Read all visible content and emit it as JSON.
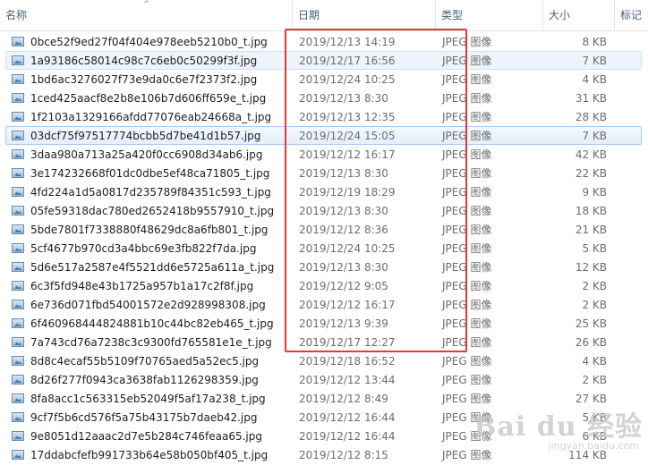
{
  "columns": {
    "name": "名称",
    "date": "日期",
    "type": "类型",
    "size": "大小",
    "tags": "标记"
  },
  "files": [
    {
      "name": "0bce52f9ed27f04f404e978eeb5210b0_t.jpg",
      "date": "2019/12/13 14:19",
      "type": "JPEG 图像",
      "size": "8 KB"
    },
    {
      "name": "1a93186c58014c98c7c6eb0c50299f3f.jpg",
      "date": "2019/12/17 16:56",
      "type": "JPEG 图像",
      "size": "7 KB"
    },
    {
      "name": "1bd6ac3276027f73e9da0c6e7f2373f2.jpg",
      "date": "2019/12/24 10:25",
      "type": "JPEG 图像",
      "size": "4 KB"
    },
    {
      "name": "1ced425aacf8e2b8e106b7d606ff659e_t.jpg",
      "date": "2019/12/13 8:30",
      "type": "JPEG 图像",
      "size": "31 KB"
    },
    {
      "name": "1f2103a1329166afdd77076eab24668a_t.jpg",
      "date": "2019/12/13 12:35",
      "type": "JPEG 图像",
      "size": "28 KB"
    },
    {
      "name": "03dcf75f97517774bcbb5d7be41d1b57.jpg",
      "date": "2019/12/24 15:05",
      "type": "JPEG 图像",
      "size": "7 KB"
    },
    {
      "name": "3daa980a713a25a420f0cc6908d34ab6.jpg",
      "date": "2019/12/12 16:17",
      "type": "JPEG 图像",
      "size": "42 KB"
    },
    {
      "name": "3e174232668f01dc0dbe5ef48ca71805_t.jpg",
      "date": "2019/12/13 8:30",
      "type": "JPEG 图像",
      "size": "22 KB"
    },
    {
      "name": "4fd224a1d5a0817d235789f84351c593_t.jpg",
      "date": "2019/12/19 18:29",
      "type": "JPEG 图像",
      "size": "9 KB"
    },
    {
      "name": "05fe59318dac780ed2652418b9557910_t.jpg",
      "date": "2019/12/13 8:30",
      "type": "JPEG 图像",
      "size": "18 KB"
    },
    {
      "name": "5bde7801f7338880f48629dc8a6fb801_t.jpg",
      "date": "2019/12/12 8:36",
      "type": "JPEG 图像",
      "size": "21 KB"
    },
    {
      "name": "5cf4677b970cd3a4bbc69e3fb822f7da.jpg",
      "date": "2019/12/24 10:25",
      "type": "JPEG 图像",
      "size": "5 KB"
    },
    {
      "name": "5d6e517a2587e4f5521dd6e5725a611a_t.jpg",
      "date": "2019/12/13 8:30",
      "type": "JPEG 图像",
      "size": "12 KB"
    },
    {
      "name": "6c3f5fd948e43b1725a957b1a17c2f8f.jpg",
      "date": "2019/12/12 9:05",
      "type": "JPEG 图像",
      "size": "2 KB"
    },
    {
      "name": "6e736d071fbd54001572e2d928998308.jpg",
      "date": "2019/12/12 16:17",
      "type": "JPEG 图像",
      "size": "2 KB"
    },
    {
      "name": "6f460968444824881b10c44bc82eb465_t.jpg",
      "date": "2019/12/13 9:39",
      "type": "JPEG 图像",
      "size": "25 KB"
    },
    {
      "name": "7a743cd76a7238c3c9300fd765581e1e_t.jpg",
      "date": "2019/12/17 12:27",
      "type": "JPEG 图像",
      "size": "26 KB"
    },
    {
      "name": "8d8c4ecaf55b5109f70765aed5a52ec5.jpg",
      "date": "2019/12/18 16:52",
      "type": "JPEG 图像",
      "size": "4 KB"
    },
    {
      "name": "8d26f277f0943ca3638fab1126298359.jpg",
      "date": "2019/12/12 13:44",
      "type": "JPEG 图像",
      "size": "2 KB"
    },
    {
      "name": "8fa8acc1c563315eb52049f5af17a238_t.jpg",
      "date": "2019/12/12 8:49",
      "type": "JPEG 图像",
      "size": "27 KB"
    },
    {
      "name": "9cf7f5b6cd576f5a75b43175b7daeb42.jpg",
      "date": "2019/12/12 16:44",
      "type": "JPEG 图像",
      "size": "5 KB"
    },
    {
      "name": "9e8051d12aaac2d7e5b284c746feaa65.jpg",
      "date": "2019/12/12 16:44",
      "type": "JPEG 图像",
      "size": "6 KB"
    },
    {
      "name": "17ddabcfefb991733b64e58b050bf405_t.jpg",
      "date": "2019/12/12 8:15",
      "type": "JPEG 图像",
      "size": "114 KB"
    }
  ],
  "watermark": {
    "logo": "Bai du 经验",
    "url": "jingyan.baidu.com"
  },
  "colors": {
    "annotation_box": "#e03c31",
    "selection_border": "#a9c9ec"
  }
}
